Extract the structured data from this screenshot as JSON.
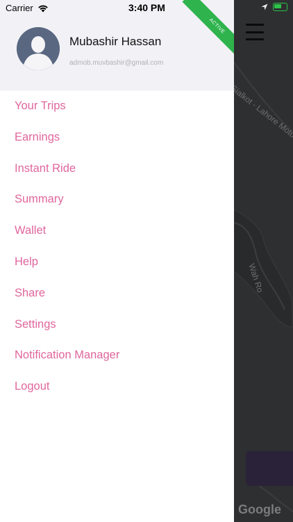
{
  "status_bar": {
    "carrier": "Carrier",
    "time": "3:40 PM"
  },
  "profile": {
    "name": "Mubashir Hassan",
    "email": "admob.muvbashir@gmail.com",
    "badge": "ACTIVE"
  },
  "menu": {
    "items": [
      {
        "label": "Your Trips"
      },
      {
        "label": "Earnings"
      },
      {
        "label": "Instant Ride"
      },
      {
        "label": "Summary"
      },
      {
        "label": "Wallet"
      },
      {
        "label": "Help"
      },
      {
        "label": "Share"
      },
      {
        "label": "Settings"
      },
      {
        "label": "Notification Manager"
      },
      {
        "label": "Logout"
      }
    ]
  },
  "map": {
    "road_label": "Sialkot - Lahore Motorway",
    "road_label_2": "Wah Ro",
    "logo": "Google"
  },
  "colors": {
    "menu_text": "#e0669d",
    "badge": "#2fb34d",
    "profile_bg": "#f1f1f6"
  }
}
